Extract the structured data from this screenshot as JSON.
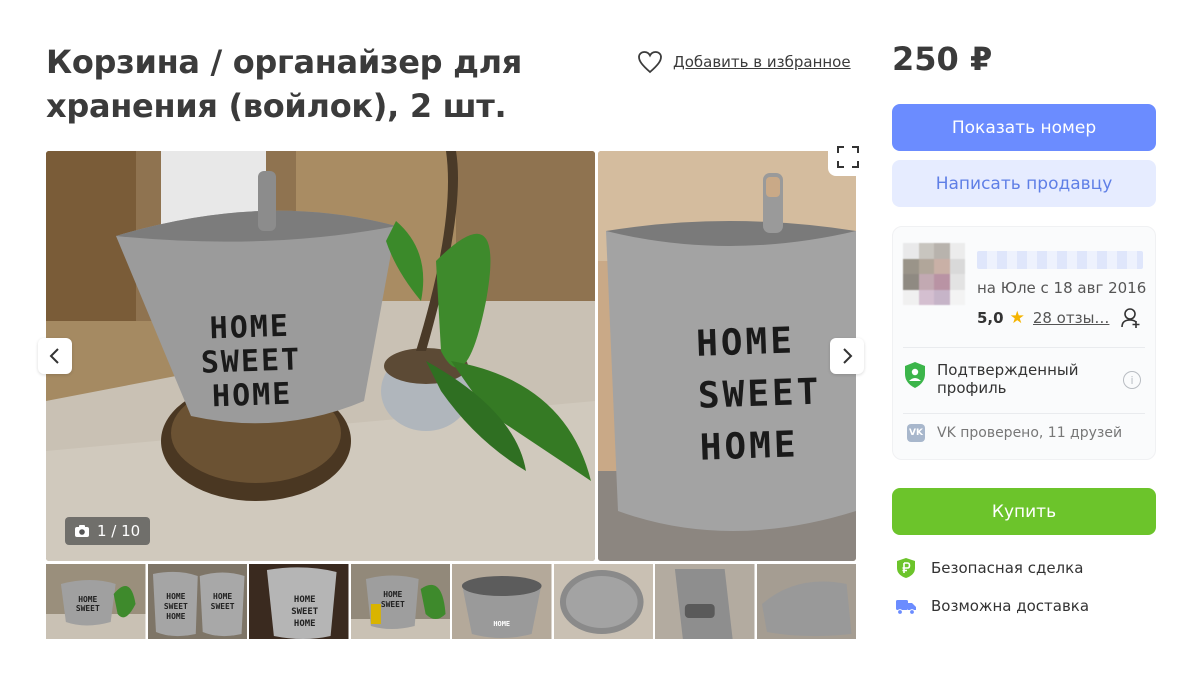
{
  "listing": {
    "title": "Корзина / органайзер для хранения (войлок), 2 шт.",
    "favorite_label": "Добавить в избранное",
    "price": "250 ₽"
  },
  "gallery": {
    "counter": "1 / 10",
    "main_print": [
      "HOME",
      "SWEET",
      "HOME"
    ],
    "second_print": [
      "HOME",
      "SWEET",
      "HOME"
    ],
    "thumbnails": [
      {
        "label": "HOME SWEET HOME",
        "bg": "#8f8a7d"
      },
      {
        "label": "HOME SWEET HOME",
        "bg": "#7e7567"
      },
      {
        "label": "HOME SWEET HOME",
        "bg": "#3a2a1f"
      },
      {
        "label": "HOME SWEET HOME",
        "bg": "#92897a"
      },
      {
        "label": "HOME",
        "bg": "#b4a99a"
      },
      {
        "label": "",
        "bg": "#c9c0b3"
      },
      {
        "label": "",
        "bg": "#b3aba0"
      },
      {
        "label": "",
        "bg": "#a59d92"
      }
    ]
  },
  "actions": {
    "show_phone": "Показать номер",
    "message_seller": "Написать продавцу",
    "buy": "Купить"
  },
  "seller": {
    "since": "на Юле с 18 авг 2016",
    "rating": "5,0",
    "reviews": "28 отзы…",
    "verified_label": "Подтвержденный профиль",
    "vk_logo": "VK",
    "vk_label": "VK проверено, 11 друзей"
  },
  "features": {
    "safe_deal": "Безопасная сделка",
    "delivery": "Возможна доставка"
  },
  "colors": {
    "primary_blue": "#6b8cff",
    "light_blue": "#e6ecff",
    "green": "#6cc42b",
    "verified_green": "#3bb54a",
    "text": "#3b3b3b"
  },
  "icons": {
    "favorite": "heart-icon",
    "camera": "camera-icon",
    "prev": "chevron-left-icon",
    "next": "chevron-right-icon",
    "fullscreen": "expand-icon",
    "subscribe": "add-user-icon",
    "verified": "shield-check-icon",
    "info": "info-icon",
    "safe": "ruble-shield-icon",
    "delivery": "truck-icon"
  }
}
